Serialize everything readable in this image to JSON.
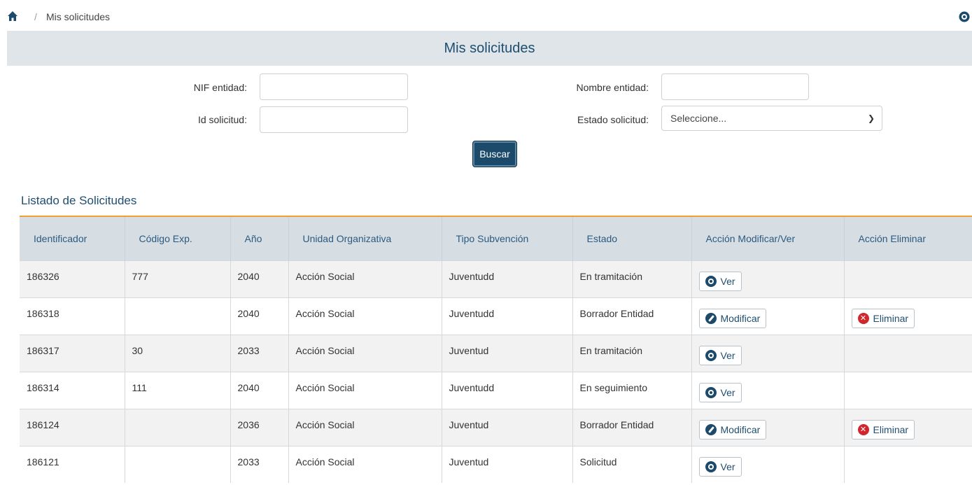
{
  "breadcrumb": {
    "home_icon": "home-icon",
    "separator": "/",
    "current": "Mis solicitudes",
    "right_icon": "eye-icon"
  },
  "panel": {
    "title": "Mis solicitudes"
  },
  "filters": {
    "nif_label": "NIF entidad:",
    "nif_value": "",
    "nombre_label": "Nombre entidad:",
    "nombre_value": "",
    "id_label": "Id solicitud:",
    "id_value": "",
    "estado_label": "Estado solicitud:",
    "estado_selected": "Seleccione...",
    "search_button": "Buscar"
  },
  "list": {
    "title": "Listado de Solicitudes",
    "columns": [
      "Identificador",
      "Código Exp.",
      "Año",
      "Unidad Organizativa",
      "Tipo Subvención",
      "Estado",
      "Acción Modificar/Ver",
      "Acción Eliminar"
    ],
    "rows": [
      {
        "id": "186326",
        "codigo": "777",
        "anio": "2040",
        "unidad": "Acción Social",
        "tipo": "Juventudd",
        "estado": "En tramitación",
        "accion": "Ver",
        "eliminar": ""
      },
      {
        "id": "186318",
        "codigo": "",
        "anio": "2040",
        "unidad": "Acción Social",
        "tipo": "Juventudd",
        "estado": "Borrador Entidad",
        "accion": "Modificar",
        "eliminar": "Eliminar"
      },
      {
        "id": "186317",
        "codigo": "30",
        "anio": "2033",
        "unidad": "Acción Social",
        "tipo": "Juventud",
        "estado": "En tramitación",
        "accion": "Ver",
        "eliminar": ""
      },
      {
        "id": "186314",
        "codigo": "111",
        "anio": "2040",
        "unidad": "Acción Social",
        "tipo": "Juventudd",
        "estado": "En seguimiento",
        "accion": "Ver",
        "eliminar": ""
      },
      {
        "id": "186124",
        "codigo": "",
        "anio": "2036",
        "unidad": "Acción Social",
        "tipo": "Juventud",
        "estado": "Borrador Entidad",
        "accion": "Modificar",
        "eliminar": "Eliminar"
      },
      {
        "id": "186121",
        "codigo": "",
        "anio": "2033",
        "unidad": "Acción Social",
        "tipo": "Juventud",
        "estado": "Solicitud",
        "accion": "Ver",
        "eliminar": ""
      }
    ]
  },
  "colors": {
    "brand": "#1c4a6b",
    "accent_rule": "#f0a030",
    "header_bg": "#dfe5e9",
    "delete": "#d0262d"
  }
}
